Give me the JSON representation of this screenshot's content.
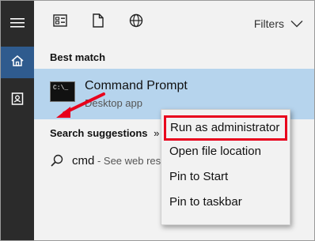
{
  "colors": {
    "rail": "#2b2b2b",
    "rail_active": "#2f5b8e",
    "selection": "#b6d4ed",
    "highlight_box": "#e8001c",
    "arrow": "#e8001c"
  },
  "rail": {
    "items": [
      {
        "icon": "hamburger-menu-icon"
      },
      {
        "icon": "home-icon"
      },
      {
        "icon": "contact-card-icon"
      }
    ]
  },
  "toolbar": {
    "icons": [
      "apps-icon",
      "document-icon",
      "globe-icon"
    ],
    "filters_label": "Filters"
  },
  "best_match": {
    "heading": "Best match",
    "app_name": "Command Prompt",
    "app_type": "Desktop app",
    "icon_glyph": "C:\\_"
  },
  "suggestions": {
    "heading": "Search suggestions",
    "heading_chevron": "»",
    "items": [
      {
        "query": "cmd",
        "hint": " - See web res"
      }
    ]
  },
  "context_menu": {
    "items": [
      {
        "label": "Run as administrator",
        "highlighted": true
      },
      {
        "label": "Open file location"
      },
      {
        "label": "Pin to Start"
      },
      {
        "label": "Pin to taskbar"
      }
    ]
  }
}
